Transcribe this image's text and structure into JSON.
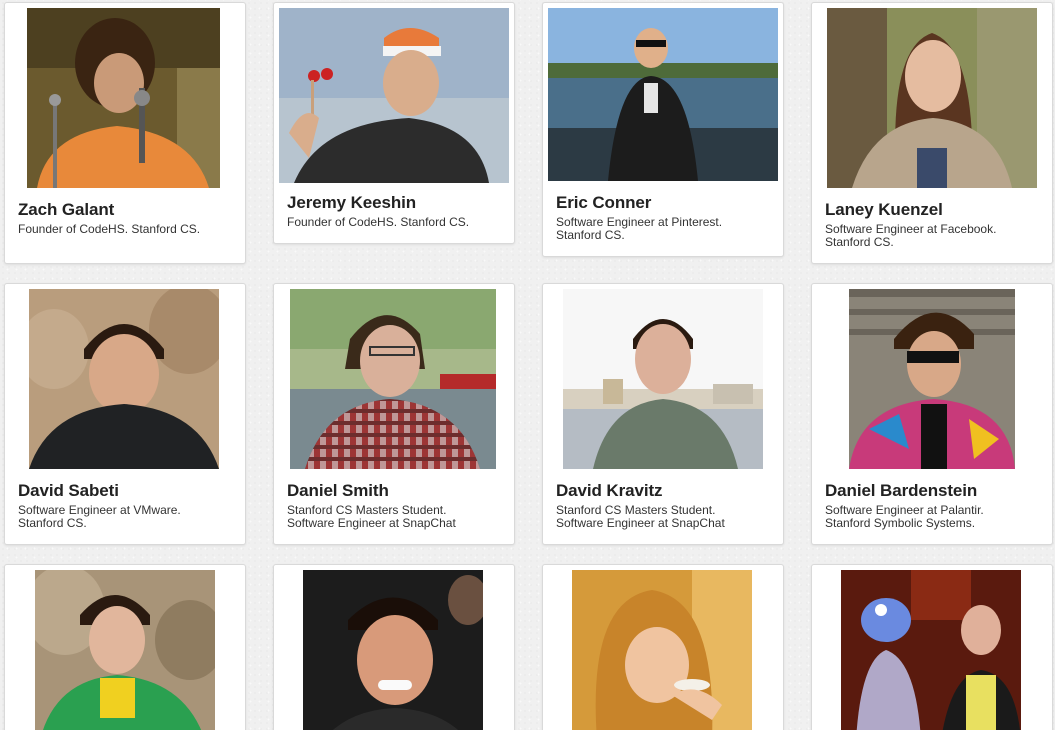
{
  "people": [
    {
      "name": "Zach Galant",
      "bio": "Founder of CodeHS. Stanford CS.",
      "photo_icon": "portrait-singer-microphone"
    },
    {
      "name": "Jeremy Keeshin",
      "bio": "Founder of CodeHS. Stanford CS.",
      "photo_icon": "portrait-cap-juggling"
    },
    {
      "name": "Eric Conner",
      "bio": "Software Engineer at Pinterest.\nStanford CS.",
      "photo_icon": "portrait-boat-lake"
    },
    {
      "name": "Laney Kuenzel",
      "bio": "Software Engineer at Facebook.\nStanford CS.",
      "photo_icon": "portrait-outdoors-tree"
    },
    {
      "name": "David Sabeti",
      "bio": "Software Engineer at VMware.\nStanford CS.",
      "photo_icon": "portrait-desert-rocks"
    },
    {
      "name": "Daniel Smith",
      "bio": "Stanford CS Masters Student.\nSoftware Engineer at SnapChat",
      "photo_icon": "portrait-glasses-plaid"
    },
    {
      "name": "David Kravitz",
      "bio": "Stanford CS Masters Student.\nSoftware Engineer at SnapChat",
      "photo_icon": "portrait-city-river"
    },
    {
      "name": "Daniel Bardenstein",
      "bio": "Software Engineer at Palantir.\nStanford Symbolic Systems.",
      "photo_icon": "portrait-sunglasses-jacket"
    },
    {
      "name": "",
      "bio": "",
      "photo_icon": "portrait-green-jacket"
    },
    {
      "name": "",
      "bio": "",
      "photo_icon": "portrait-smiling-dark"
    },
    {
      "name": "",
      "bio": "",
      "photo_icon": "portrait-curly-hair-eating"
    },
    {
      "name": "",
      "bio": "",
      "photo_icon": "portrait-muppet-yellow-shirt"
    }
  ]
}
